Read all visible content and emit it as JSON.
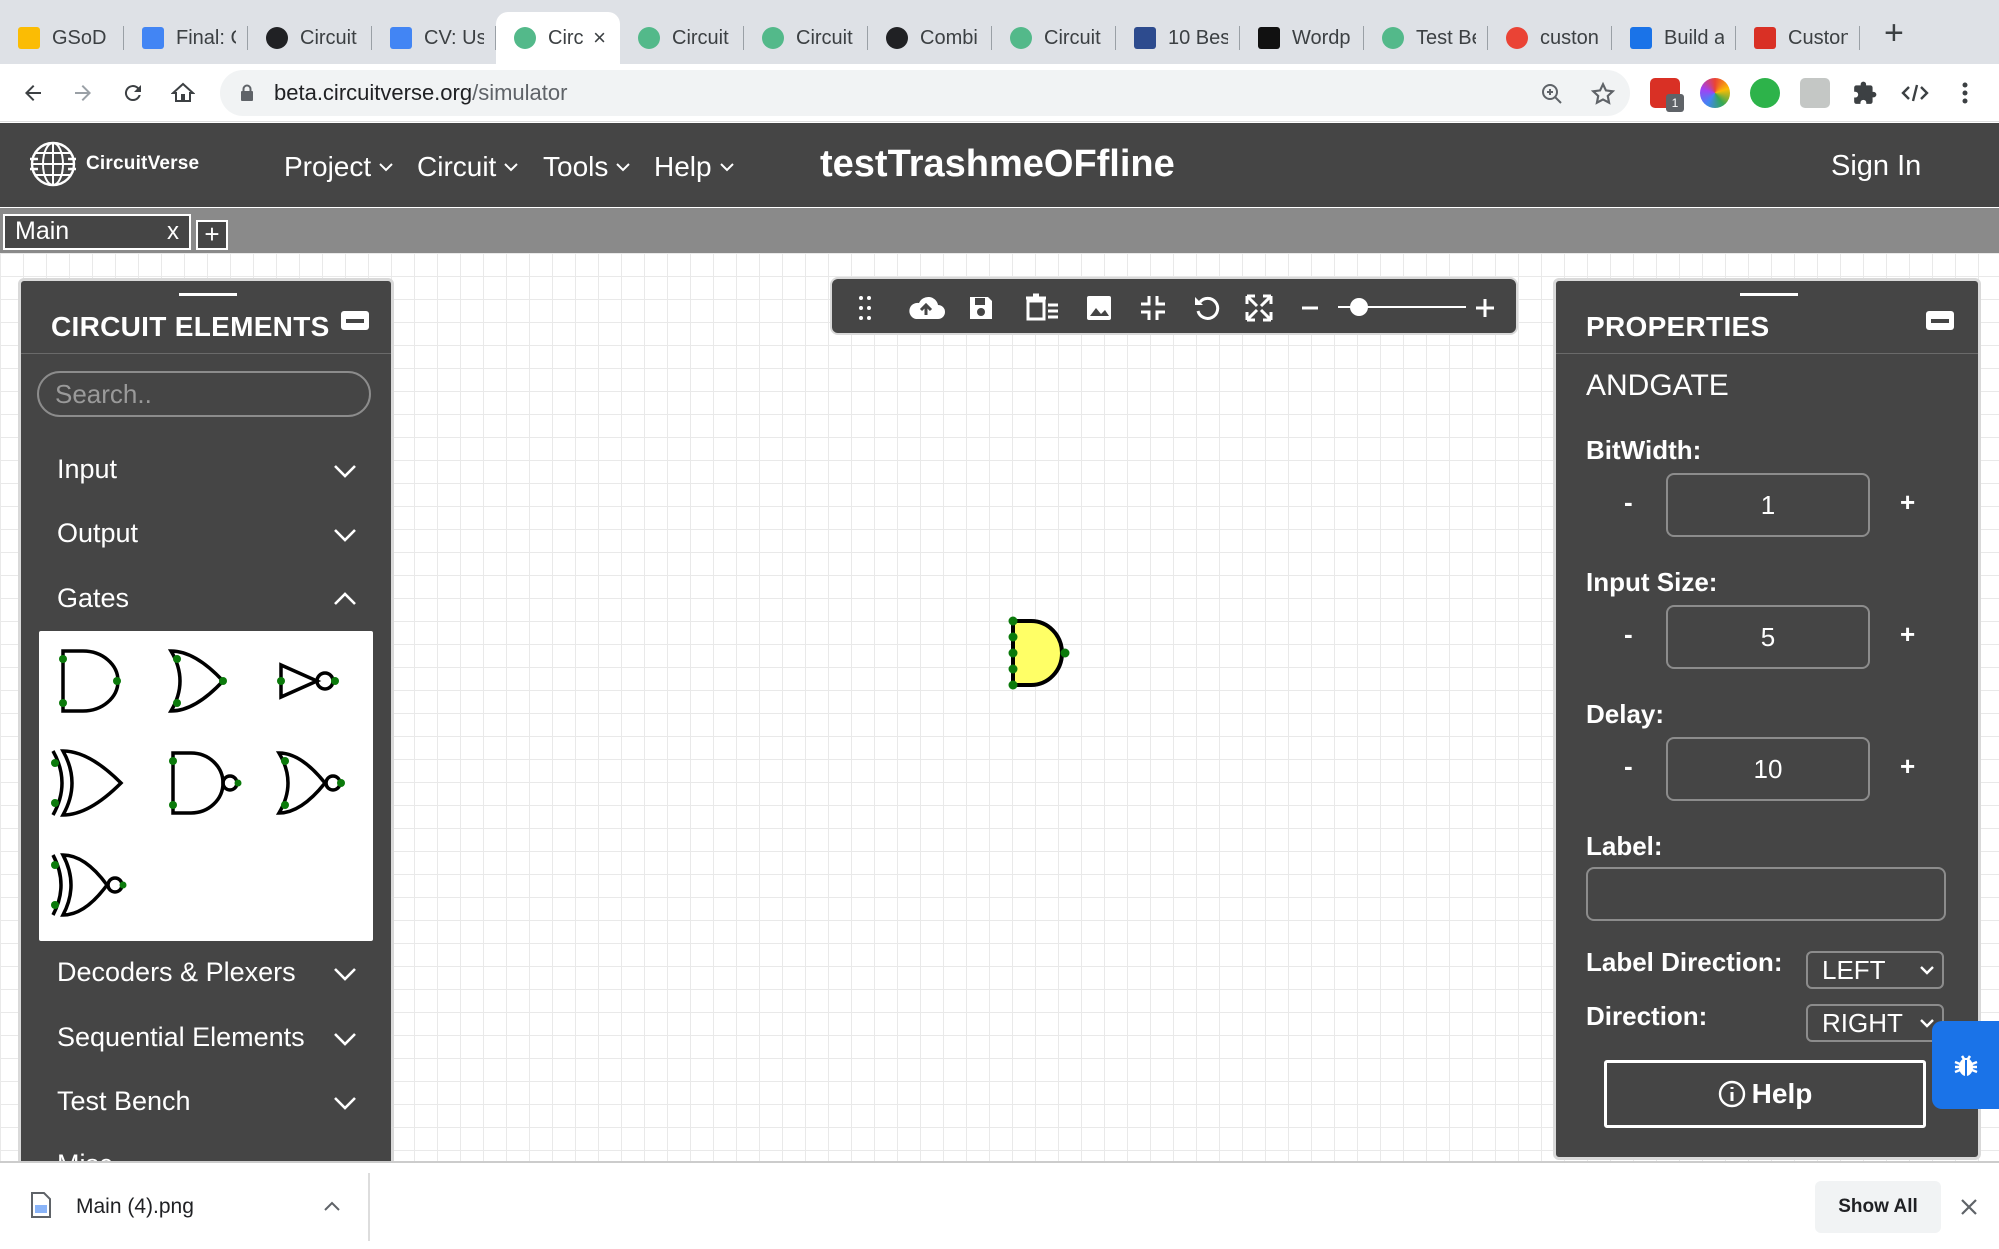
{
  "browser": {
    "tabs": [
      {
        "title": "GSoD ",
        "fav": "google-drive-icon",
        "color": "#fbbc04"
      },
      {
        "title": "Final: C",
        "fav": "docs-icon",
        "color": "#4285f4"
      },
      {
        "title": "Circuit",
        "fav": "globe-icon",
        "color": "#202124"
      },
      {
        "title": "CV: Us",
        "fav": "docs-icon",
        "color": "#4285f4"
      },
      {
        "title": "Circ",
        "fav": "circuitverse-icon",
        "color": "#53b98a",
        "active": true
      },
      {
        "title": "Circuit",
        "fav": "circuitverse-icon",
        "color": "#53b98a"
      },
      {
        "title": "Circuit",
        "fav": "circuitverse-icon",
        "color": "#53b98a"
      },
      {
        "title": "Combi",
        "fav": "globe-icon",
        "color": "#202124"
      },
      {
        "title": "Circuit",
        "fav": "circuitverse-icon",
        "color": "#53b98a"
      },
      {
        "title": "10 Bes",
        "fav": "shield-icon",
        "color": "#2d4b8e"
      },
      {
        "title": "Wordp",
        "fav": "m-icon",
        "color": "#111111"
      },
      {
        "title": "Test Be",
        "fav": "circuitverse-icon",
        "color": "#53b98a"
      },
      {
        "title": "custon",
        "fav": "google-icon",
        "color": "#ea4335"
      },
      {
        "title": "Build a",
        "fav": "chart-icon",
        "color": "#1a73e8"
      },
      {
        "title": "Custon",
        "fav": "red-app-icon",
        "color": "#d93025"
      }
    ],
    "url_host": "beta.circuitverse.org",
    "url_path": "/simulator",
    "extension_badge": "1"
  },
  "app": {
    "logo_text": "CircuitVerse",
    "menus": [
      "Project",
      "Circuit",
      "Tools",
      "Help"
    ],
    "project_title": "testTrashmeOFfline",
    "sign_in": "Sign In"
  },
  "sheet_tabs": {
    "main_label": "Main",
    "close": "x",
    "add": "+"
  },
  "elements_panel": {
    "title": "CIRCUIT ELEMENTS",
    "search_placeholder": "Search..",
    "categories": [
      {
        "label": "Input",
        "expanded": false
      },
      {
        "label": "Output",
        "expanded": false
      },
      {
        "label": "Gates",
        "expanded": true
      },
      {
        "label": "Decoders & Plexers",
        "expanded": false
      },
      {
        "label": "Sequential Elements",
        "expanded": false
      },
      {
        "label": "Test Bench",
        "expanded": false
      },
      {
        "label": "Misc",
        "expanded": false
      }
    ],
    "gates": [
      "and-gate",
      "or-gate",
      "not-gate",
      "xor-gate",
      "nand-gate",
      "nor-gate",
      "xnor-gate"
    ]
  },
  "properties_panel": {
    "title": "PROPERTIES",
    "element_name": "ANDGATE",
    "bitwidth_label": "BitWidth:",
    "bitwidth_value": "1",
    "input_size_label": "Input Size:",
    "input_size_value": "5",
    "delay_label": "Delay:",
    "delay_value": "10",
    "label_label": "Label:",
    "label_value": "",
    "label_direction_label": "Label Direction:",
    "label_direction_value": "LEFT",
    "direction_label": "Direction:",
    "direction_value": "RIGHT",
    "minus": "-",
    "plus": "+",
    "help_label": "Help"
  },
  "download_bar": {
    "filename": "Main (4).png",
    "show_all": "Show All"
  },
  "colors": {
    "app_bg": "#454545",
    "gate_fill": "#ffff66",
    "node_color": "#0b7a0b"
  }
}
